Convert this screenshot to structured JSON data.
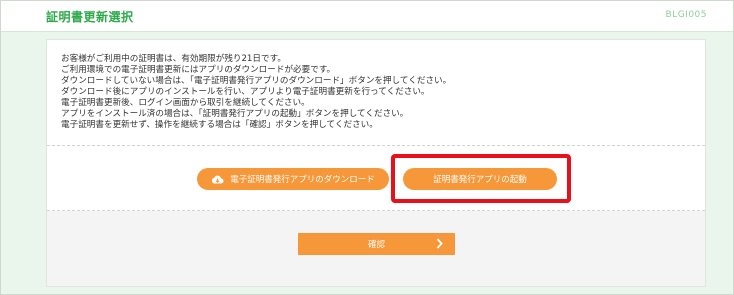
{
  "header": {
    "title": "証明書更新選択",
    "screen_id": "BLGI005"
  },
  "notice": {
    "lines": [
      "お客様がご利用中の証明書は、有効期限が残り21日です。",
      "ご利用環境での電子証明書更新にはアプリのダウンロードが必要です。",
      "ダウンロードしていない場合は、「電子証明書発行アプリのダウンロード」ボタンを押してください。",
      "ダウンロード後にアプリのインストールを行い、アプリより電子証明書更新を行ってください。",
      "電子証明書更新後、ログイン画面から取引を継続してください。",
      "アプリをインストール済の場合は、「証明書発行アプリの起動」ボタンを押してください。",
      "電子証明書を更新せず、操作を継続する場合は「確認」ボタンを押してください。"
    ]
  },
  "actions": {
    "download_label": "電子証明書発行アプリのダウンロード",
    "download_icon": "cloud-download-icon",
    "launch_label": "証明書発行アプリの起動",
    "confirm_label": "確認",
    "confirm_icon": "chevron-right-icon"
  },
  "colors": {
    "brand_green": "#2ea84a",
    "button_orange": "#f6983a",
    "highlight_red": "#e8101a"
  }
}
